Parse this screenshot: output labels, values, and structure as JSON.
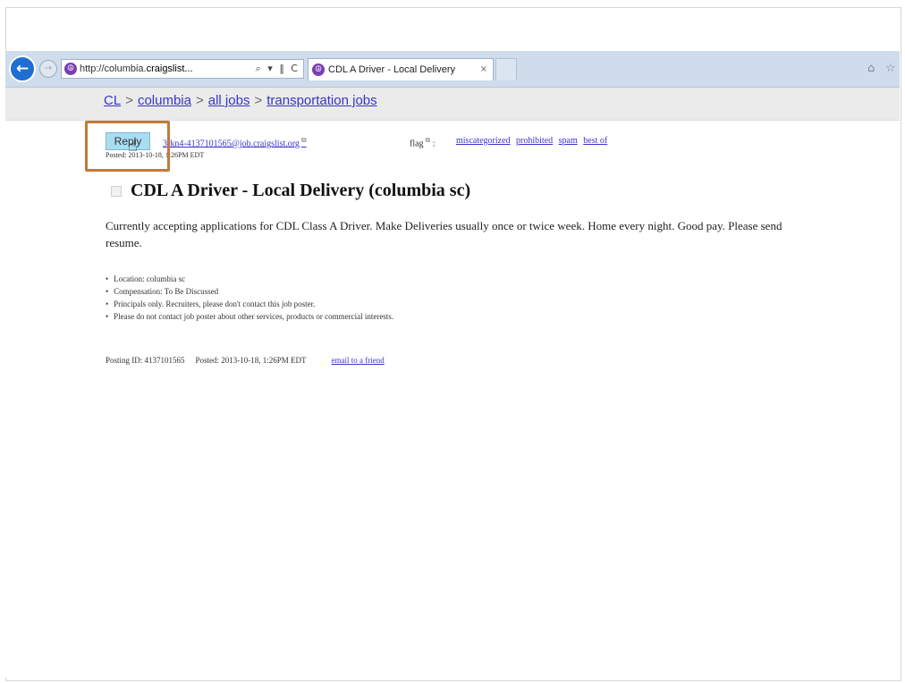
{
  "browser": {
    "address_prefix": "http://columbia.",
    "address_host": "craigslist...",
    "address_tools": "⌕ ▾ ‖ C",
    "tab_title": "CDL A Driver - Local Delivery",
    "tab_close": "×"
  },
  "breadcrumb": {
    "items": [
      "CL",
      "columbia",
      "all jobs",
      "transportation jobs"
    ],
    "separator": ">"
  },
  "reply": {
    "button_label": "Reply",
    "email": "3rkn4-4137101565@job.craigslist.org",
    "posted_small": "Posted: 2013-10-18, 1:26PM EDT"
  },
  "flag": {
    "label": "flag",
    "separator": ":",
    "links": [
      "miscategorized",
      "prohibited",
      "spam",
      "best of"
    ]
  },
  "post": {
    "title": "CDL A Driver - Local Delivery (columbia sc)",
    "body": "Currently accepting applications for CDL Class A Driver. Make Deliveries usually once or twice week. Home every night. Good pay. Please send resume.",
    "attributes": [
      "Location: columbia sc",
      "Compensation: To Be Discussed",
      "Principals only. Recruiters, please don't contact this job poster.",
      "Please do not contact job poster about other services, products or commercial interests."
    ]
  },
  "footer": {
    "posting_id": "Posting ID: 4137101565",
    "posted": "Posted: 2013-10-18, 1:26PM EDT",
    "email_friend": "email to a friend"
  },
  "icons": {
    "back": "←",
    "forward": "→",
    "site": "☮",
    "home": "⌂",
    "favorites": "☆",
    "external": "⧉",
    "cursor": "☝"
  },
  "colors": {
    "link": "#3a33cc",
    "reply_button": "#a9def2",
    "highlight_box": "#c07a3a",
    "chrome": "#cfdcec",
    "back_button": "#1e6fd1"
  }
}
